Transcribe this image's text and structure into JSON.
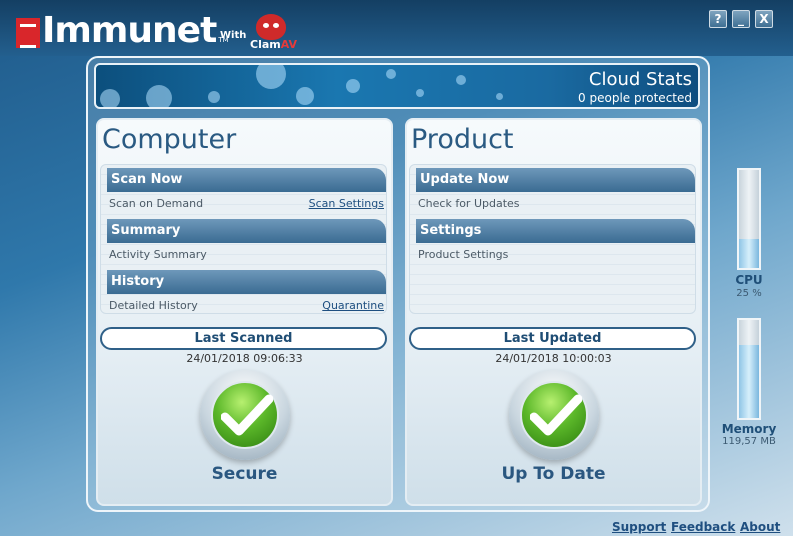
{
  "app": {
    "logo_text": "Immunet",
    "trademark": "TM",
    "with_text": "With",
    "partner_logo_clam": "Clam",
    "partner_logo_av": "AV"
  },
  "window_controls": {
    "help": "?",
    "minimize": "_",
    "close": "X"
  },
  "cloud_stats": {
    "title": "Cloud Stats",
    "subtitle": "0 people protected"
  },
  "computer_panel": {
    "title": "Computer",
    "items": [
      {
        "label": "Scan Now",
        "desc": "Scan on Demand",
        "link": "Scan Settings"
      },
      {
        "label": "Summary",
        "desc": "Activity Summary",
        "link": ""
      },
      {
        "label": "History",
        "desc": "Detailed History",
        "link": "Quarantine"
      }
    ],
    "pill_label": "Last Scanned",
    "timestamp": "24/01/2018 09:06:33",
    "status": "Secure"
  },
  "product_panel": {
    "title": "Product",
    "items": [
      {
        "label": "Update Now",
        "desc": "Check for Updates"
      },
      {
        "label": "Settings",
        "desc": "Product Settings"
      }
    ],
    "pill_label": "Last Updated",
    "timestamp": "24/01/2018 10:00:03",
    "status": "Up To Date"
  },
  "meters": {
    "cpu": {
      "label": "CPU",
      "value": "25 %",
      "fill_fraction": 0.3
    },
    "memory": {
      "label": "Memory",
      "value": "119,57 MB",
      "fill_fraction": 0.75
    }
  },
  "footer": {
    "support": "Support",
    "feedback": "Feedback",
    "about": "About"
  },
  "colors": {
    "accent": "#2a5a82",
    "status_green": "#5cb82a",
    "brand_red": "#d9262b"
  },
  "icons": {
    "status_check": "check-icon",
    "mascot": "clamav-devil-icon"
  }
}
